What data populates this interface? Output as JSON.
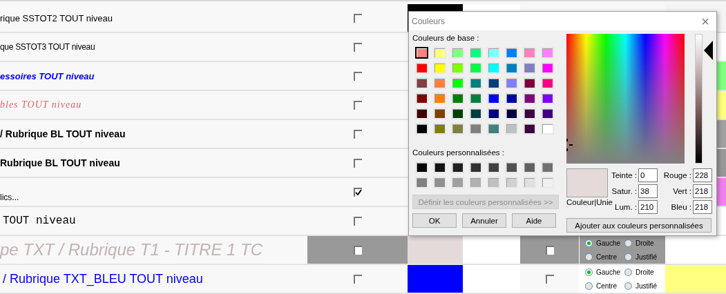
{
  "table": {
    "rows": [
      {
        "kind": "plain",
        "text": "rique SSTOT2 TOUT niveau",
        "checked": false,
        "selected": false,
        "swatch": {
          "color": "#000000"
        },
        "highlight": {
          "color": "#f4f4f4"
        }
      },
      {
        "kind": "narrow",
        "text": "que SSTOT3 TOUT niveau",
        "checked": false,
        "selected": false
      },
      {
        "kind": "blue-italic",
        "text": "essoires TOUT niveau",
        "checked": false,
        "selected": false,
        "highlight": {
          "color": "#80ff80"
        }
      },
      {
        "kind": "serif-italic",
        "text": "bles TOUT niveau",
        "checked": false,
        "selected": false,
        "highlight": {
          "color": "#ffff80"
        }
      },
      {
        "kind": "bold",
        "text": "/ Rubrique BL TOUT niveau",
        "checked": false,
        "selected": false,
        "highlight": {
          "color": "#a0a0a0"
        }
      },
      {
        "kind": "bold",
        "text": "Rubrique BL TOUT niveau",
        "checked": false,
        "selected": false,
        "highlight": {
          "color": "#989898"
        }
      },
      {
        "kind": "small-low",
        "text": "lics...",
        "checked": true,
        "selected": false,
        "highlight": {
          "color": "#f080f0"
        }
      },
      {
        "kind": "mono",
        "text": "TOUT niveau",
        "checked": false,
        "selected": false
      },
      {
        "kind": "large",
        "text": "pe TXT / Rubrique T1 - TITRE 1 TC",
        "checked": false,
        "selected": true,
        "swatch": {
          "color": "#e4dada"
        },
        "checked_2": false,
        "alignment": [
          {
            "label": "Gauche",
            "selected": true
          },
          {
            "label": "Droite",
            "selected": false
          },
          {
            "label": "Centre",
            "selected": false
          },
          {
            "label": "Justifié",
            "selected": false
          }
        ]
      },
      {
        "kind": "blue-large",
        "text": "/ Rubrique TXT_BLEU TOUT niveau",
        "checked": false,
        "selected": false,
        "swatch": {
          "color": "#0000ff"
        },
        "checked_2": false,
        "alignment": [
          {
            "label": "Gauche",
            "selected": true
          },
          {
            "label": "Droite",
            "selected": false
          },
          {
            "label": "Centre",
            "selected": false
          },
          {
            "label": "Justifié",
            "selected": false
          }
        ],
        "highlight": {
          "color": "#ffff80"
        }
      }
    ]
  },
  "dialog": {
    "title": "Couleurs",
    "close": "×",
    "base_label": "Couleurs de base :",
    "base_colors": [
      {
        "color": "#ff8080",
        "selected": true
      },
      {
        "color": "#ffff80",
        "selected": false
      },
      {
        "color": "#80ff80",
        "selected": false
      },
      {
        "color": "#00ff80",
        "selected": false
      },
      {
        "color": "#80ffff",
        "selected": false
      },
      {
        "color": "#0080ff",
        "selected": false
      },
      {
        "color": "#ff80c0",
        "selected": false
      },
      {
        "color": "#ff80ff",
        "selected": false
      },
      {
        "color": "#ff0000",
        "selected": false
      },
      {
        "color": "#ffff00",
        "selected": false
      },
      {
        "color": "#80ff00",
        "selected": false
      },
      {
        "color": "#00ff40",
        "selected": false
      },
      {
        "color": "#00ffff",
        "selected": false
      },
      {
        "color": "#0080c0",
        "selected": false
      },
      {
        "color": "#8080c0",
        "selected": false
      },
      {
        "color": "#ff00ff",
        "selected": false
      },
      {
        "color": "#804040",
        "selected": false
      },
      {
        "color": "#ff8040",
        "selected": false
      },
      {
        "color": "#00ff00",
        "selected": false
      },
      {
        "color": "#008080",
        "selected": false
      },
      {
        "color": "#004080",
        "selected": false
      },
      {
        "color": "#8080ff",
        "selected": false
      },
      {
        "color": "#800040",
        "selected": false
      },
      {
        "color": "#ff0080",
        "selected": false
      },
      {
        "color": "#800000",
        "selected": false
      },
      {
        "color": "#ff8000",
        "selected": false
      },
      {
        "color": "#008000",
        "selected": false
      },
      {
        "color": "#008040",
        "selected": false
      },
      {
        "color": "#0000ff",
        "selected": false
      },
      {
        "color": "#0000a0",
        "selected": false
      },
      {
        "color": "#800080",
        "selected": false
      },
      {
        "color": "#8000ff",
        "selected": false
      },
      {
        "color": "#400000",
        "selected": false
      },
      {
        "color": "#804000",
        "selected": false
      },
      {
        "color": "#004000",
        "selected": false
      },
      {
        "color": "#004040",
        "selected": false
      },
      {
        "color": "#000080",
        "selected": false
      },
      {
        "color": "#000040",
        "selected": false
      },
      {
        "color": "#400040",
        "selected": false
      },
      {
        "color": "#400080",
        "selected": false
      },
      {
        "color": "#000000",
        "selected": false
      },
      {
        "color": "#808000",
        "selected": false
      },
      {
        "color": "#808040",
        "selected": false
      },
      {
        "color": "#808080",
        "selected": false
      },
      {
        "color": "#408080",
        "selected": false
      },
      {
        "color": "#c0c0c0",
        "selected": false
      },
      {
        "color": "#400040",
        "selected": false
      },
      {
        "color": "#ffffff",
        "selected": false
      }
    ],
    "custom_label": "Couleurs personnalisées :",
    "custom_colors": [
      {
        "color": "#000000",
        "selected": false
      },
      {
        "color": "#141414",
        "selected": false
      },
      {
        "color": "#202020",
        "selected": false
      },
      {
        "color": "#303030",
        "selected": false
      },
      {
        "color": "#404040",
        "selected": false
      },
      {
        "color": "#505050",
        "selected": false
      },
      {
        "color": "#606060",
        "selected": false
      },
      {
        "color": "#707070",
        "selected": false
      },
      {
        "color": "#808080",
        "selected": false
      },
      {
        "color": "#909090",
        "selected": false
      },
      {
        "color": "#a0a0a0",
        "selected": false
      },
      {
        "color": "#b0b0b0",
        "selected": false
      },
      {
        "color": "#c0c0c0",
        "selected": false
      },
      {
        "color": "#d0d0d0",
        "selected": false
      },
      {
        "color": "#e0e0e0",
        "selected": false
      },
      {
        "color": "#f0f0f0",
        "selected": false
      }
    ],
    "define_button": {
      "label": "Définir les couleurs personnalisées >>",
      "disabled": true
    },
    "buttons": [
      "OK",
      "Annuler",
      "Aide"
    ],
    "preview": {
      "color": "#e4dada",
      "label": "Couleur|Unie"
    },
    "fields": [
      {
        "label": "Teinte :",
        "value": "0"
      },
      {
        "label": "Rouge :",
        "value": "228"
      },
      {
        "label": "Satur. :",
        "value": "38"
      },
      {
        "label": "Vert :",
        "value": "218"
      },
      {
        "label": "Lum. :",
        "value": "210"
      },
      {
        "label": "Bleu :",
        "value": "218"
      }
    ],
    "add_button": "Ajouter aux couleurs personnalisées"
  }
}
